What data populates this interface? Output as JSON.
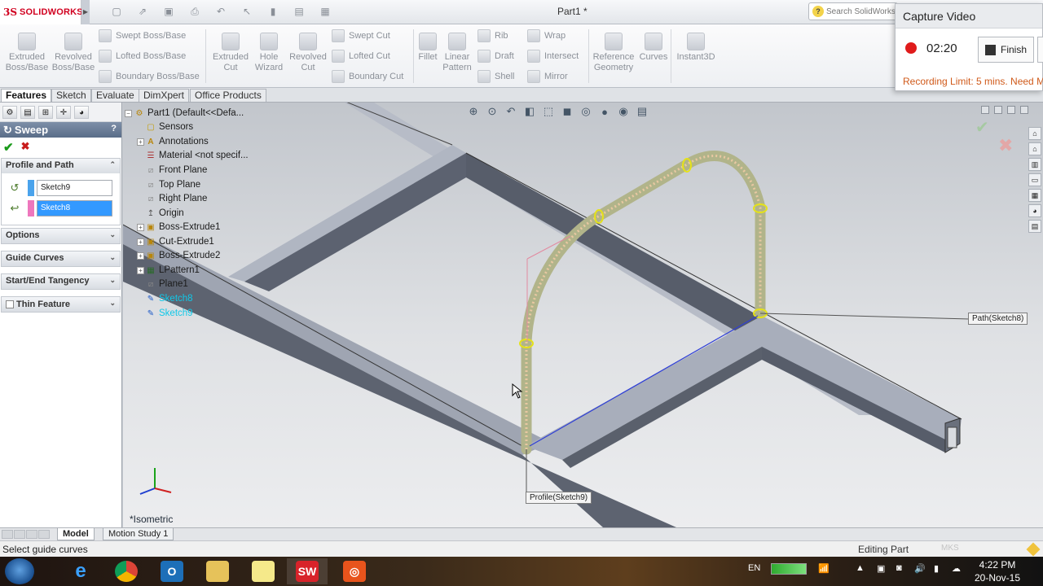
{
  "app": {
    "brand_prefix": "3S",
    "brand_name": "SOLIDWORKS",
    "document_title": "Part1 *",
    "search_placeholder": "Search SolidWorks"
  },
  "ribbon": {
    "buttons": [
      {
        "id": "extruded-boss",
        "label": "Extruded\nBoss/Base"
      },
      {
        "id": "revolved-boss",
        "label": "Revolved\nBoss/Base"
      },
      {
        "id": "extruded-cut",
        "label": "Extruded\nCut"
      },
      {
        "id": "hole-wizard",
        "label": "Hole\nWizard"
      },
      {
        "id": "revolved-cut",
        "label": "Revolved\nCut"
      },
      {
        "id": "fillet",
        "label": "Fillet"
      },
      {
        "id": "linear-pattern",
        "label": "Linear\nPattern"
      },
      {
        "id": "reference-geometry",
        "label": "Reference\nGeometry"
      },
      {
        "id": "curves",
        "label": "Curves"
      },
      {
        "id": "instant3d",
        "label": "Instant3D"
      }
    ],
    "small": {
      "swept_boss": "Swept Boss/Base",
      "lofted_boss": "Lofted Boss/Base",
      "boundary_boss": "Boundary Boss/Base",
      "swept_cut": "Swept Cut",
      "lofted_cut": "Lofted Cut",
      "boundary_cut": "Boundary Cut",
      "rib": "Rib",
      "draft": "Draft",
      "shell": "Shell",
      "wrap": "Wrap",
      "intersect": "Intersect",
      "mirror": "Mirror"
    }
  },
  "capture_video": {
    "title": "Capture Video",
    "elapsed": "02:20",
    "finish_label": "Finish",
    "limit_text": "Recording Limit: 5 mins. Need M"
  },
  "tabs": [
    "Features",
    "Sketch",
    "Evaluate",
    "DimXpert",
    "Office Products"
  ],
  "property_manager": {
    "title": "Sweep",
    "help": "?",
    "groups": {
      "profile_path": "Profile and Path",
      "options": "Options",
      "guide_curves": "Guide Curves",
      "start_end_tangency": "Start/End Tangency",
      "thin_feature": "Thin Feature"
    },
    "profile_value": "Sketch9",
    "path_value": "Sketch8",
    "profile_color": "#4aa3ec",
    "path_color": "#ee77bd"
  },
  "feature_tree": [
    {
      "label": "Part1  (Default<<Defa...",
      "icon": "part-icon",
      "style": "normal"
    },
    {
      "label": "Sensors",
      "icon": "sensor-icon",
      "style": "normal"
    },
    {
      "label": "Annotations",
      "icon": "annotation-icon",
      "style": "normal"
    },
    {
      "label": "Material <not specif...",
      "icon": "material-icon",
      "style": "normal"
    },
    {
      "label": "Front Plane",
      "icon": "plane-icon",
      "style": "normal"
    },
    {
      "label": "Top Plane",
      "icon": "plane-icon",
      "style": "normal"
    },
    {
      "label": "Right Plane",
      "icon": "plane-icon",
      "style": "normal"
    },
    {
      "label": "Origin",
      "icon": "origin-icon",
      "style": "normal"
    },
    {
      "label": "Boss-Extrude1",
      "icon": "extrude-icon",
      "style": "normal"
    },
    {
      "label": "Cut-Extrude1",
      "icon": "cut-icon",
      "style": "normal"
    },
    {
      "label": "Boss-Extrude2",
      "icon": "extrude-icon",
      "style": "normal"
    },
    {
      "label": "LPattern1",
      "icon": "pattern-icon",
      "style": "normal"
    },
    {
      "label": "Plane1",
      "icon": "plane-icon",
      "style": "normal"
    },
    {
      "label": "Sketch8",
      "icon": "sketch-icon",
      "style": "cyan"
    },
    {
      "label": "Sketch9",
      "icon": "sketch-icon",
      "style": "cyan"
    }
  ],
  "viewport": {
    "path_callout": "Path(Sketch8)",
    "profile_callout": "Profile(Sketch9)",
    "view_name": "*Isometric"
  },
  "model_tabs": [
    "Model",
    "Motion Study 1"
  ],
  "statusbar": {
    "left": "Select guide curves",
    "right": "Editing Part",
    "units": "MKS"
  },
  "taskbar": {
    "language": "EN",
    "time": "4:22 PM",
    "date": "20-Nov-15"
  }
}
